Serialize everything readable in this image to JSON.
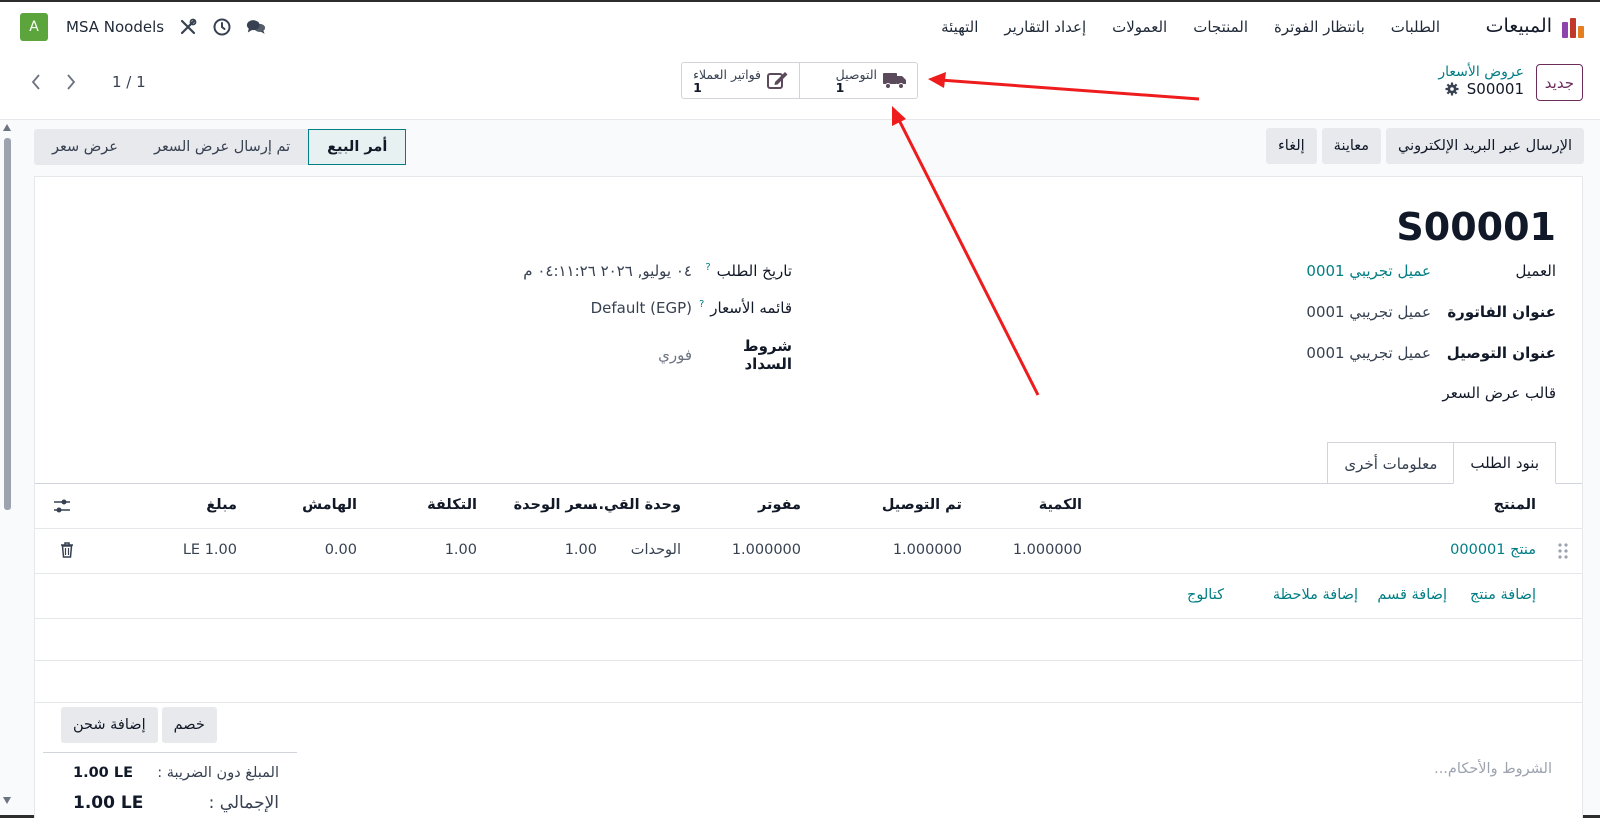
{
  "navbar": {
    "app_name": "المبيعات",
    "menu": [
      "الطلبات",
      "بانتظار الفوترة",
      "المنتجات",
      "العمولات",
      "إعداد التقارير",
      "التهيئة"
    ],
    "company": "MSA Noodels",
    "avatar_letter": "A",
    "brand_colors": [
      "#e67e22",
      "#c0392b",
      "#8e44ad"
    ]
  },
  "control": {
    "new_label": "جديد",
    "breadcrumb_parent": "عروض الأسعار",
    "breadcrumb_current": "S00001",
    "smart_buttons": [
      {
        "label": "التوصيل",
        "count": "1",
        "icon": "truck-icon"
      },
      {
        "label": "فواتير العملاء",
        "count": "1",
        "icon": "edit-icon"
      }
    ],
    "pager": "1 / 1"
  },
  "actions": {
    "send_email": "الإرسال عبر البريد الإلكتروني",
    "preview": "معاينة",
    "cancel": "إلغاء"
  },
  "status": {
    "stages": [
      "أمر البيع",
      "تم إرسال عرض السعر",
      "عرض سعر"
    ],
    "active": "أمر البيع"
  },
  "form": {
    "order_name": "S00001",
    "customer_label": "العميل",
    "customer_value": "عميل تجريبي 0001",
    "invoice_addr_label": "عنوان الفاتورة",
    "invoice_addr_value": "عميل تجريبي 0001",
    "delivery_addr_label": "عنوان التوصيل",
    "delivery_addr_value": "عميل تجريبي 0001",
    "quote_template_label": "قالب عرض السعر",
    "order_date_label": "تاريخ الطلب",
    "order_date_value": "٠٤ يوليو, ٢٠٢٦ ٠٤:١١:٢٦ م",
    "pricelist_label": "قائمه الأسعار",
    "pricelist_value": "Default (EGP)",
    "payment_terms_label": "شروط السداد",
    "payment_terms_value": "فوري",
    "help_mark": "?"
  },
  "tabs": [
    "بنود الطلب",
    "معلومات أخرى"
  ],
  "table": {
    "headers": {
      "product": "المنتج",
      "qty": "الكمية",
      "delivered": "تم التوصيل",
      "invoiced": "مفوتر",
      "uom": "وحدة القي...",
      "unit_price": "سعر الوحدة",
      "cost": "التكلفة",
      "margin": "الهامش",
      "amount": "مبلغ"
    },
    "row": {
      "product": "منتج 000001",
      "qty": "1.000000",
      "delivered": "1.000000",
      "invoiced": "1.000000",
      "uom": "الوحدات",
      "unit_price": "1.00",
      "cost": "1.00",
      "margin": "0.00",
      "amount": "1.00 LE"
    },
    "add_links": {
      "add_product": "إضافة منتج",
      "add_section": "إضافة قسم",
      "add_note": "إضافة ملاحظة",
      "catalog": "كتالوج"
    }
  },
  "footer": {
    "discount": "خصم",
    "add_shipping": "إضافة شحن",
    "untaxed_label": "المبلغ دون الضريبة :",
    "untaxed_value": "1.00 LE",
    "total_label": "الإجمالي :",
    "total_value": "1.00 LE",
    "terms_placeholder": "الشروط والأحكام..."
  },
  "colors": {
    "accent": "#017e84",
    "primary": "#6b2c5c",
    "arrow": "#ee1c1c"
  }
}
